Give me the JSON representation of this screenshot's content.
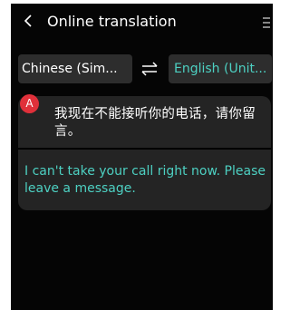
{
  "header": {
    "title": "Online translation",
    "back_icon": "chevron-left-icon",
    "menu_icon": "menu-icon"
  },
  "languages": {
    "source": "Chinese (Sim...",
    "target": "English (Unit...",
    "swap_icon": "swap-arrows-icon"
  },
  "conversation": {
    "speaker_badge": "A",
    "source_text": "我现在不能接听你的电话，请你留言。",
    "translated_text": "I can't take your call right now. Please leave a message."
  },
  "colors": {
    "background": "#050505",
    "panel": "#2d2d2d",
    "accent": "#4dd0c2",
    "badge": "#e0303a"
  }
}
